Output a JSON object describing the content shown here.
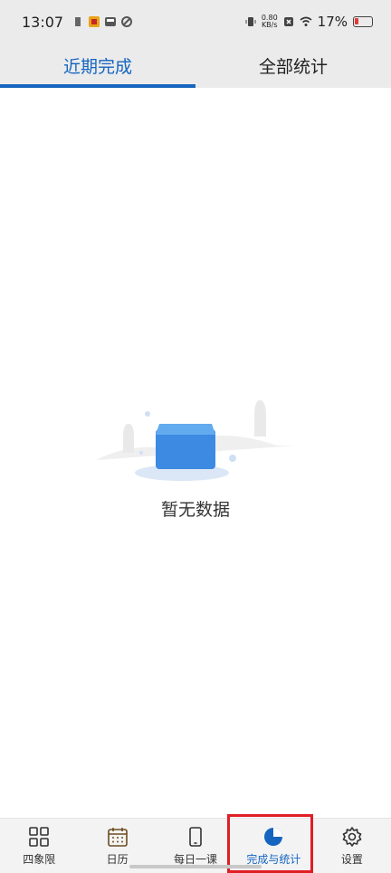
{
  "status_bar": {
    "time": "13:07",
    "net_speed_value": "0.80",
    "net_speed_unit": "KB/s",
    "battery_percent": "17%"
  },
  "tabs": [
    {
      "label": "近期完成",
      "active": true
    },
    {
      "label": "全部统计",
      "active": false
    }
  ],
  "empty_state": {
    "text": "暂无数据"
  },
  "bottom_nav": [
    {
      "label": "四象限",
      "icon": "quadrant-grid-icon"
    },
    {
      "label": "日历",
      "icon": "calendar-icon"
    },
    {
      "label": "每日一课",
      "icon": "phone-icon"
    },
    {
      "label": "完成与统计",
      "icon": "pie-chart-icon",
      "active": true
    },
    {
      "label": "设置",
      "icon": "gear-icon"
    }
  ],
  "colors": {
    "accent": "#1565c0",
    "highlight": "#e01e25"
  }
}
